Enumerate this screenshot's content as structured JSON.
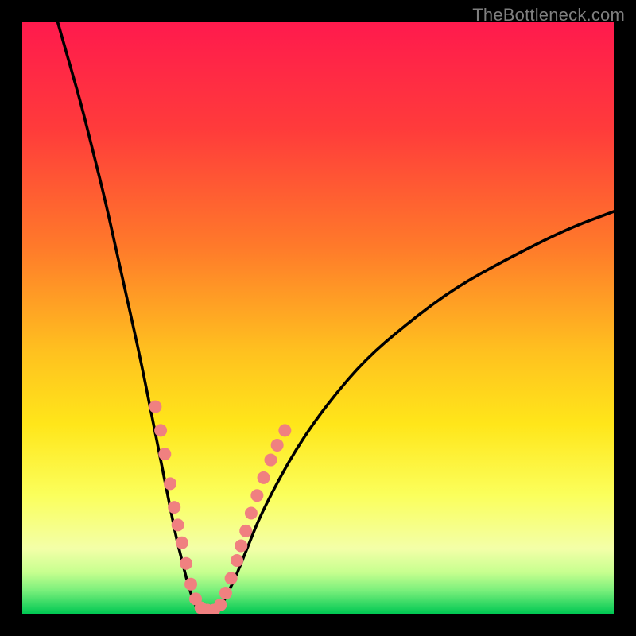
{
  "watermark": "TheBottleneck.com",
  "chart_data": {
    "type": "line",
    "title": "",
    "xlabel": "",
    "ylabel": "",
    "xlim": [
      0,
      100
    ],
    "ylim": [
      0,
      100
    ],
    "grid": false,
    "gradient_stops": [
      {
        "offset": 0,
        "color": "#ff1a4d"
      },
      {
        "offset": 18,
        "color": "#ff3b3b"
      },
      {
        "offset": 38,
        "color": "#ff7a2a"
      },
      {
        "offset": 56,
        "color": "#ffc21f"
      },
      {
        "offset": 68,
        "color": "#ffe61a"
      },
      {
        "offset": 80,
        "color": "#fbff5c"
      },
      {
        "offset": 89,
        "color": "#f3ffa8"
      },
      {
        "offset": 93,
        "color": "#c7ff8f"
      },
      {
        "offset": 96,
        "color": "#7cf07c"
      },
      {
        "offset": 100,
        "color": "#00c853"
      }
    ],
    "series": [
      {
        "name": "left-branch",
        "x": [
          6,
          8,
          10,
          12,
          14,
          16,
          18,
          20,
          22,
          24,
          25,
          26,
          27,
          28,
          29,
          30
        ],
        "y": [
          100,
          93,
          86,
          78,
          70,
          61,
          52,
          43,
          33,
          23,
          18,
          13,
          9,
          5,
          2,
          0
        ]
      },
      {
        "name": "right-branch",
        "x": [
          33,
          34,
          36,
          38,
          40,
          43,
          47,
          52,
          58,
          65,
          73,
          82,
          92,
          100
        ],
        "y": [
          0,
          2,
          6,
          11,
          16,
          22,
          29,
          36,
          43,
          49,
          55,
          60,
          65,
          68
        ]
      },
      {
        "name": "valley-flat",
        "x": [
          30,
          31.5,
          33
        ],
        "y": [
          0,
          0,
          0
        ]
      }
    ],
    "dots": {
      "name": "markers",
      "points": [
        {
          "x": 22.5,
          "y": 35
        },
        {
          "x": 23.4,
          "y": 31
        },
        {
          "x": 24.1,
          "y": 27
        },
        {
          "x": 25.0,
          "y": 22
        },
        {
          "x": 25.7,
          "y": 18
        },
        {
          "x": 26.3,
          "y": 15
        },
        {
          "x": 27.0,
          "y": 12
        },
        {
          "x": 27.7,
          "y": 8.5
        },
        {
          "x": 28.5,
          "y": 5
        },
        {
          "x": 29.3,
          "y": 2.5
        },
        {
          "x": 30.2,
          "y": 1
        },
        {
          "x": 31.3,
          "y": 0.6
        },
        {
          "x": 32.4,
          "y": 0.6
        },
        {
          "x": 33.5,
          "y": 1.5
        },
        {
          "x": 34.4,
          "y": 3.5
        },
        {
          "x": 35.3,
          "y": 6
        },
        {
          "x": 36.3,
          "y": 9
        },
        {
          "x": 37.0,
          "y": 11.5
        },
        {
          "x": 37.8,
          "y": 14
        },
        {
          "x": 38.7,
          "y": 17
        },
        {
          "x": 39.7,
          "y": 20
        },
        {
          "x": 40.8,
          "y": 23
        },
        {
          "x": 42.0,
          "y": 26
        },
        {
          "x": 43.1,
          "y": 28.5
        },
        {
          "x": 44.4,
          "y": 31
        }
      ],
      "radius": 8
    }
  }
}
